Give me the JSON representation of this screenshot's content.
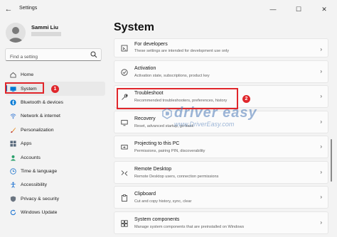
{
  "window": {
    "title": "Settings",
    "back_icon": "arrow-left-icon",
    "controls": [
      {
        "name": "minimize",
        "glyph": "—"
      },
      {
        "name": "maximize",
        "glyph": "☐"
      },
      {
        "name": "close",
        "glyph": "✕"
      }
    ]
  },
  "profile": {
    "name": "Sammi Liu"
  },
  "search": {
    "placeholder": "Find a setting",
    "icon": "search-icon"
  },
  "sidebar": {
    "items": [
      {
        "label": "Home",
        "icon": "home-icon",
        "color": "#555555"
      },
      {
        "label": "System",
        "icon": "system-icon",
        "color": "#0078d4",
        "active": true
      },
      {
        "label": "Bluetooth & devices",
        "icon": "bluetooth-icon",
        "color": "#0078d4"
      },
      {
        "label": "Network & internet",
        "icon": "network-icon",
        "color": "#3a7bd5"
      },
      {
        "label": "Personalization",
        "icon": "brush-icon",
        "color": "#e8912d"
      },
      {
        "label": "Apps",
        "icon": "apps-icon",
        "color": "#5a6a7c"
      },
      {
        "label": "Accounts",
        "icon": "accounts-icon",
        "color": "#2aa06b"
      },
      {
        "label": "Time & language",
        "icon": "clock-globe-icon",
        "color": "#2f7fcf"
      },
      {
        "label": "Accessibility",
        "icon": "accessibility-icon",
        "color": "#1a6fd1"
      },
      {
        "label": "Privacy & security",
        "icon": "shield-icon",
        "color": "#6a7480"
      },
      {
        "label": "Windows Update",
        "icon": "update-icon",
        "color": "#1b73d1"
      }
    ]
  },
  "main": {
    "title": "System",
    "cards": [
      {
        "title": "For developers",
        "desc": "These settings are intended for development use only",
        "icon": "developer-icon"
      },
      {
        "title": "Activation",
        "desc": "Activation state, subscriptions, product key",
        "icon": "activation-icon"
      },
      {
        "title": "Troubleshoot",
        "desc": "Recommended troubleshooters, preferences, history",
        "icon": "wrench-icon"
      },
      {
        "title": "Recovery",
        "desc": "Reset, advanced startup, go back",
        "icon": "recovery-icon"
      },
      {
        "title": "Projecting to this PC",
        "desc": "Permissions, pairing PIN, discoverability",
        "icon": "projector-icon"
      },
      {
        "title": "Remote Desktop",
        "desc": "Remote Desktop users, connection permissions",
        "icon": "remote-desktop-icon"
      },
      {
        "title": "Clipboard",
        "desc": "Cut and copy history, sync, clear",
        "icon": "clipboard-icon"
      },
      {
        "title": "System components",
        "desc": "Manage system components that are preinstalled on Windows",
        "icon": "components-icon"
      }
    ]
  },
  "annotations": {
    "step1": "1",
    "step2": "2",
    "highlight_color": "#e0262b"
  },
  "watermark": {
    "name": "driver easy",
    "url": "www.DriverEasy.com"
  }
}
